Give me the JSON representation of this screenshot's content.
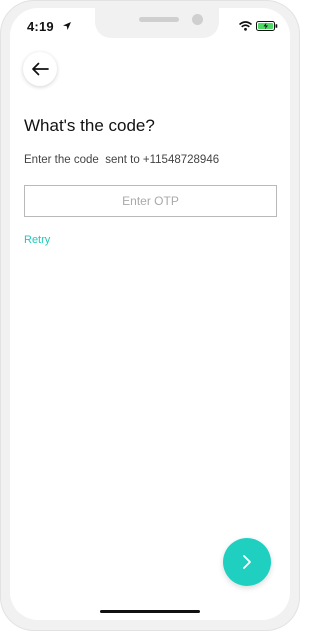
{
  "status_bar": {
    "time": "4:19"
  },
  "header": {
    "title": "What's the code?",
    "subtitle": "Enter the code  sent to +11548728946"
  },
  "otp": {
    "placeholder": "Enter OTP",
    "value": ""
  },
  "actions": {
    "retry_label": "Retry"
  },
  "icons": {
    "back": "arrow-left-icon",
    "next": "chevron-right-icon",
    "location": "location-arrow-icon",
    "wifi": "wifi-icon",
    "battery": "battery-charging-icon"
  },
  "colors": {
    "accent": "#1fd0c1",
    "retry_text": "#24c8b8",
    "battery_fill": "#4cd964"
  }
}
